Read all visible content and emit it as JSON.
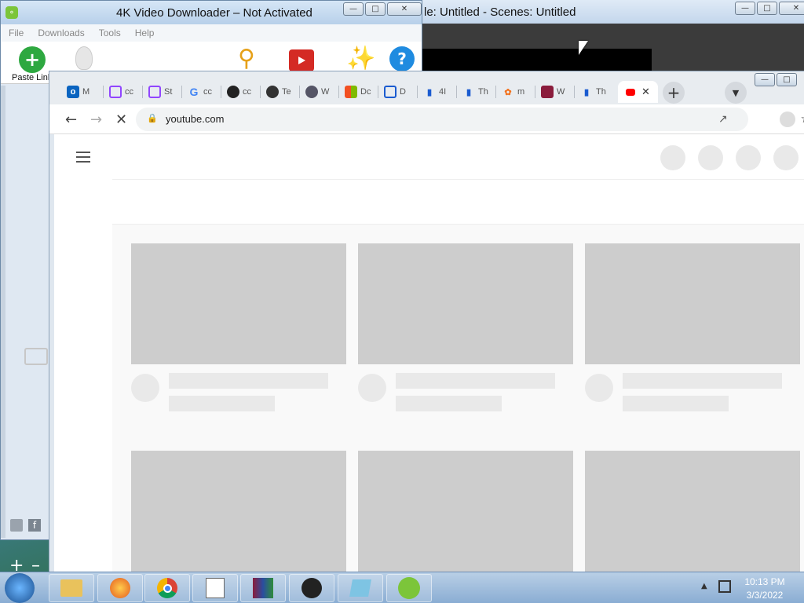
{
  "k4": {
    "title": "4K Video Downloader – Not Activated",
    "menu": [
      "File",
      "Downloads",
      "Tools",
      "Help"
    ],
    "paste_link": "Paste Link",
    "icons": [
      "paste-link-icon",
      "smart-mode-icon",
      "activate-key-icon",
      "subscriptions-icon",
      "preferences-icon",
      "help-icon"
    ],
    "sidebar_bottom": [
      "youtube-icon",
      "facebook-icon"
    ]
  },
  "obs": {
    "title": "le: Untitled - Scenes: Untitled"
  },
  "chrome": {
    "tabs": [
      {
        "icon": "outlook-icon",
        "label": "M"
      },
      {
        "icon": "twitch-icon",
        "label": "cc"
      },
      {
        "icon": "twitch-icon",
        "label": "St"
      },
      {
        "icon": "google-icon",
        "label": "cc"
      },
      {
        "icon": "github-icon",
        "label": "cc"
      },
      {
        "icon": "obs-icon",
        "label": "Te"
      },
      {
        "icon": "globe-icon",
        "label": "W"
      },
      {
        "icon": "microsoft-icon",
        "label": "Dc"
      },
      {
        "icon": "monitor-icon",
        "label": "D"
      },
      {
        "icon": "bar-chart-icon",
        "label": "4I"
      },
      {
        "icon": "bar-chart-icon",
        "label": "Th"
      },
      {
        "icon": "flower-icon",
        "label": "m"
      },
      {
        "icon": "winrar-icon",
        "label": "W"
      },
      {
        "icon": "bar-chart-icon",
        "label": "Th"
      }
    ],
    "active_tab_icon": "youtube-icon",
    "url": "youtube.com"
  },
  "taskbar": {
    "time": "10:13 PM",
    "date": "3/3/2022",
    "apps": [
      "explorer-icon",
      "firefox-icon",
      "chrome-icon",
      "notepad-list-icon",
      "winrar-icon",
      "obs-icon",
      "files-icon",
      "4k-downloader-icon"
    ]
  }
}
